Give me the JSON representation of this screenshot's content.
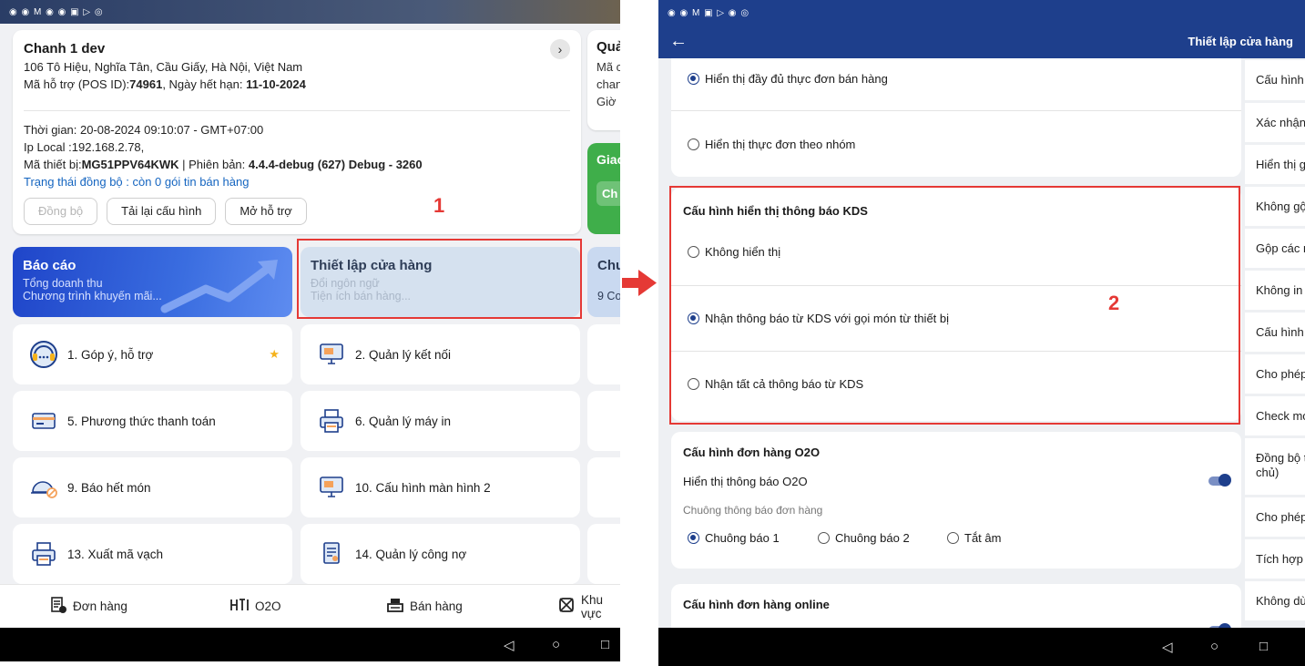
{
  "left": {
    "status_icons": "◉ ◉ M ◉ ◉ ▣ ▷ ◎",
    "store": {
      "name": "Chanh 1 dev",
      "address": "106 Tô Hiệu, Nghĩa Tân, Cầu Giấy, Hà Nội, Việt Nam",
      "pos_prefix": "Mã hỗ trợ (POS ID):",
      "pos_id": "74961",
      "expiry_prefix": ", Ngày hết hạn: ",
      "expiry": "11-10-2024",
      "time": "Thời gian: 20-08-2024 09:10:07 - GMT+07:00",
      "ip": "Ip Local :192.168.2.78,",
      "device_prefix": "Mã thiết bị:",
      "device": "MG51PPV64KWK",
      "version_prefix": " | Phiên bản: ",
      "version": "4.4.4-debug (627) Debug - 3260",
      "sync_status": "Trạng thái đồng bộ : còn 0 gói tin bán hàng",
      "btn_sync": "Đồng bộ",
      "btn_reload": "Tải lại cấu hình",
      "btn_support": "Mở hỗ trợ"
    },
    "peek_card": {
      "title": "Quả",
      "line1": "Mã c",
      "line2": "chan",
      "line3": "Giờ r"
    },
    "peek_green": {
      "title": "Giao",
      "inner": "Ch"
    },
    "annotation_1": "1",
    "annotation_2": "2",
    "banners": {
      "report": {
        "title": "Báo cáo",
        "line1": "Tổng doanh thu",
        "line2": "Chương trình khuyến mãi..."
      },
      "setup": {
        "title": "Thiết lập cửa hàng",
        "line1": "Đổi ngôn ngữ",
        "line2": "Tiện ích bán hàng..."
      },
      "peek": {
        "title": "Chu",
        "line2": "9 Co"
      }
    },
    "menu": [
      {
        "label": "1. Góp ý, hỗ trợ",
        "icon": "headset-icon"
      },
      {
        "label": "2. Quản lý kết nối",
        "icon": "monitor-icon"
      },
      {
        "label": "5. Phương thức thanh toán",
        "icon": "card-icon"
      },
      {
        "label": "6. Quản lý máy in",
        "icon": "printer-icon"
      },
      {
        "label": "9. Báo hết món",
        "icon": "cloche-icon"
      },
      {
        "label": "10. Cấu hình màn hình 2",
        "icon": "monitor-icon"
      },
      {
        "label": "13. Xuất mã vạch",
        "icon": "printer-icon"
      },
      {
        "label": "14. Quản lý công nợ",
        "icon": "document-icon"
      }
    ],
    "bottom_nav": {
      "orders": "Đơn hàng",
      "o2o": "O2O",
      "sales": "Bán hàng",
      "area": "Khu vực"
    }
  },
  "right": {
    "status_icons": "◉ ◉ M ▣ ▷ ◉ ◎",
    "title": "Thiết lập cửa hàng",
    "menu_display": {
      "opt_full": "Hiển thị đầy đủ thực đơn bán hàng",
      "opt_group": "Hiển thị thực đơn theo nhóm"
    },
    "kds": {
      "title": "Cấu hình hiển thị thông báo KDS",
      "opt_none": "Không hiển thị",
      "opt_device": "Nhận thông báo từ KDS với gọi món từ thiết bị",
      "opt_all": "Nhận tất cả thông báo từ KDS"
    },
    "o2o": {
      "title": "Cấu hình đơn hàng O2O",
      "show_notice": "Hiển thị thông báo O2O",
      "bell_hint": "Chuông thông báo đơn hàng",
      "bell1": "Chuông báo 1",
      "bell2": "Chuông báo 2",
      "mute": "Tắt âm"
    },
    "online": {
      "title": "Cấu hình đơn hàng online"
    },
    "side_items": [
      "Cấu hình",
      "Xác nhận",
      "Hiển thị g",
      "Không gộ",
      "Gộp các m",
      "Không in",
      "Cấu hình",
      "Cho phép",
      "Check mo",
      "Đồng bộ t",
      "chủ)",
      "Cho phép",
      "Tích hợp",
      "Không dù"
    ]
  },
  "colors": {
    "primary": "#1e3f8c",
    "annotation": "#e53935",
    "green": "#3fae4a"
  }
}
